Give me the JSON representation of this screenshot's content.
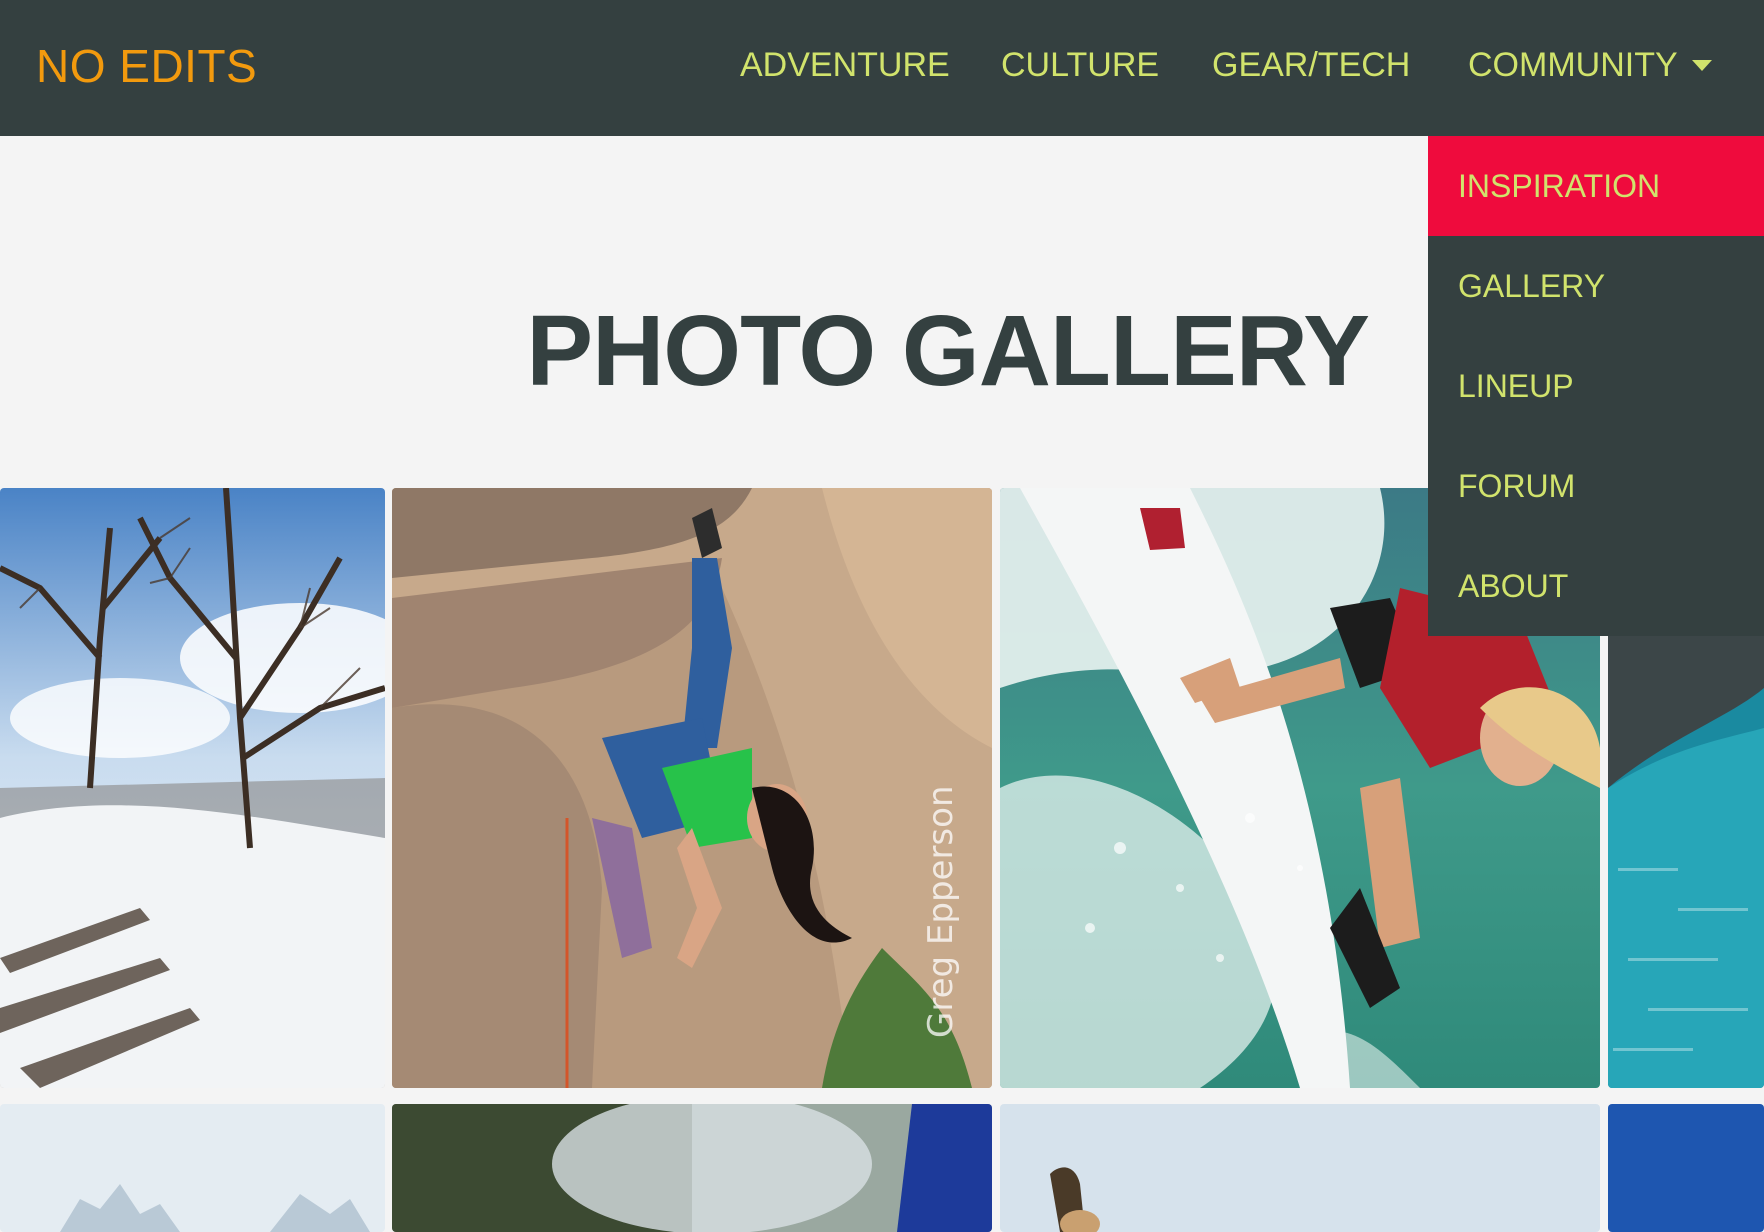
{
  "header": {
    "brand": "NO EDITS",
    "nav": {
      "adventure": "ADVENTURE",
      "culture": "CULTURE",
      "gear_tech": "GEAR/TECH",
      "community": "COMMUNITY"
    }
  },
  "dropdown": {
    "items": [
      "INSPIRATION",
      "GALLERY",
      "LINEUP",
      "FORUM",
      "ABOUT"
    ],
    "active_index": 0
  },
  "main": {
    "title": "PHOTO GALLERY"
  },
  "gallery": {
    "photos": [
      {
        "subject": "Snowy park with bare trees and steps"
      },
      {
        "subject": "Woman rock climbing on overhang"
      },
      {
        "subject": "Surfer falling into wave with surfboard"
      },
      {
        "subject": "Rock over turquoise water"
      },
      {
        "subject": "Snowy mountain peaks"
      },
      {
        "subject": "Skier with blue banner"
      },
      {
        "subject": "Person jumping against sky"
      },
      {
        "subject": "Blue water"
      }
    ],
    "watermark": "Greg Epperson"
  },
  "colors": {
    "header_bg": "#344040",
    "brand": "#f29a0e",
    "nav_text": "#d1e36c",
    "active_item": "#ef0b3d",
    "page_bg": "#f4f4f4",
    "title": "#344040"
  },
  "icons": {
    "community_caret": "chevron-down-icon"
  }
}
